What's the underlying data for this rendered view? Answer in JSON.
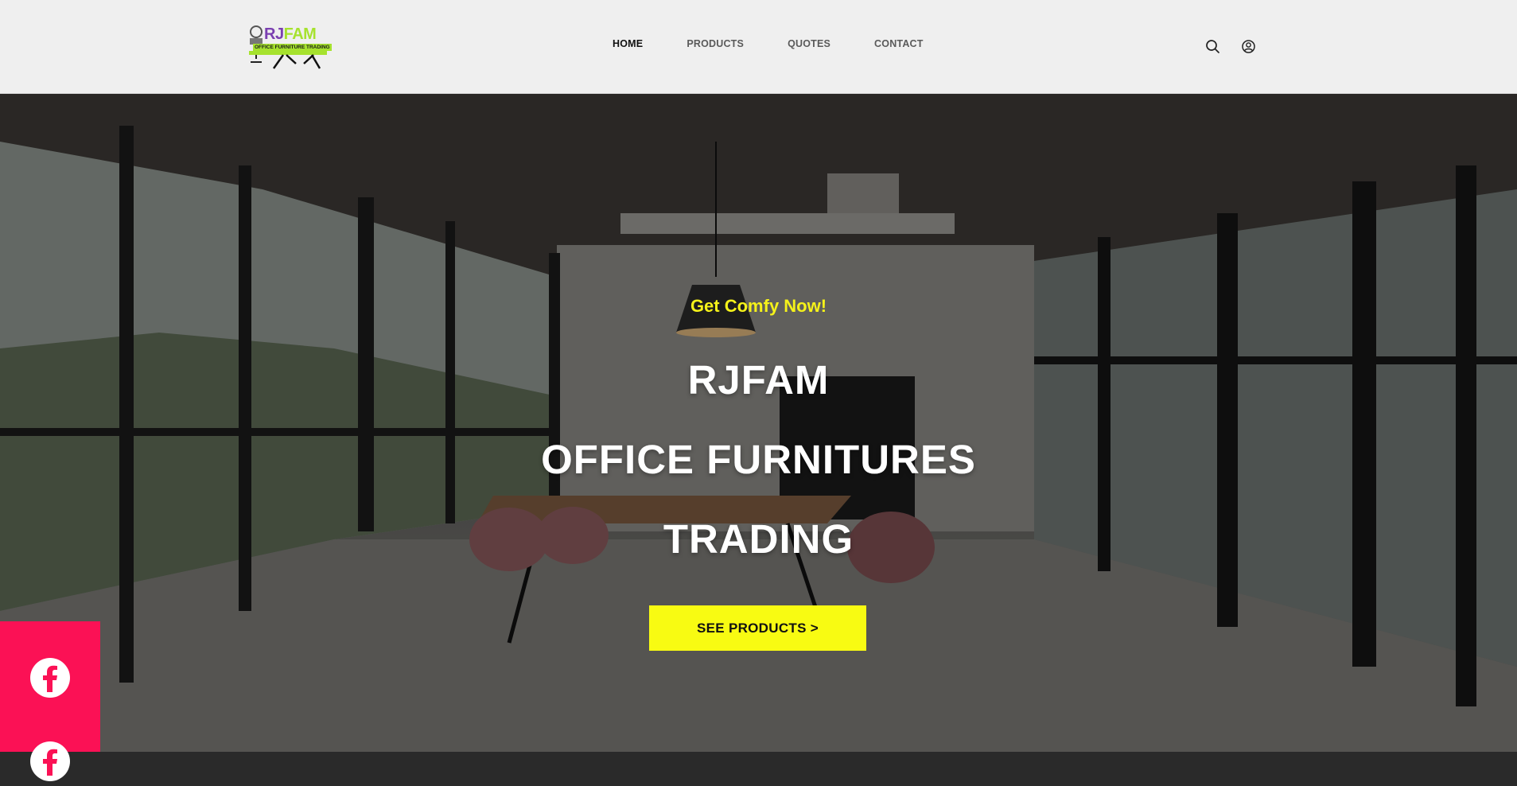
{
  "brand": {
    "logo_text_parts": [
      "RJ",
      "FAM"
    ],
    "logo_subtext": "OFFICE FURNITURE TRADING",
    "colors": {
      "accent_yellow": "#f8fb12",
      "tagline_yellow": "#f5f21a",
      "social_pink": "#fb1155",
      "logo_green": "#a6e22e",
      "logo_purple": "#7a3fb0"
    }
  },
  "nav": {
    "items": [
      {
        "label": "HOME",
        "active": true
      },
      {
        "label": "PRODUCTS",
        "active": false
      },
      {
        "label": "QUOTES",
        "active": false
      },
      {
        "label": "CONTACT",
        "active": false
      }
    ]
  },
  "header_icons": [
    "search-icon",
    "account-icon"
  ],
  "hero": {
    "tagline": "Get Comfy Now!",
    "title_lines": [
      "RJFAM",
      "OFFICE FURNITURES",
      "TRADING"
    ],
    "cta_label": "SEE PRODUCTS >"
  },
  "social": {
    "icons": [
      "facebook-icon",
      "facebook-icon"
    ]
  }
}
